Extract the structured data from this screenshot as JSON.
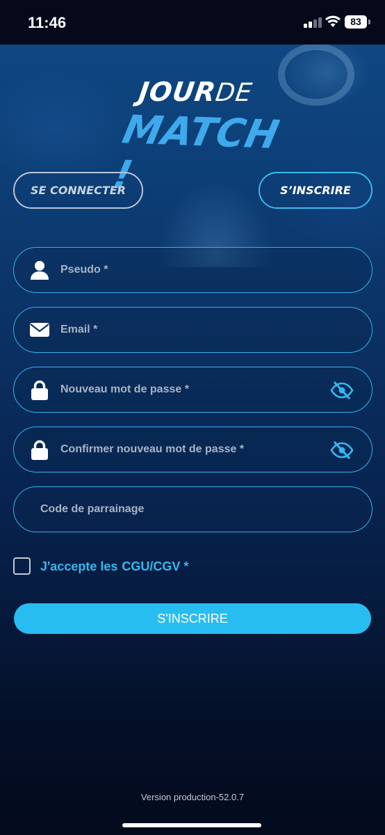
{
  "status_bar": {
    "time": "11:46",
    "battery": "83"
  },
  "logo": {
    "jour": "JOUR",
    "de": "DE",
    "match": "MATCH !"
  },
  "tabs": {
    "login": "SE CONNECTER",
    "signup": "S’INSCRIRE",
    "active": "signup"
  },
  "form": {
    "pseudo_placeholder": "Pseudo *",
    "email_placeholder": "Email *",
    "password_placeholder": "Nouveau mot de passe *",
    "confirm_placeholder": "Confirmer nouveau mot de passe *",
    "referral_placeholder": "Code de parrainage",
    "accept_text": "J'accepte les",
    "cgu_link": "CGU/CGV *",
    "accepted": false,
    "submit_label": "S'INSCRIRE"
  },
  "footer": {
    "version": "Version production-52.0.7"
  },
  "colors": {
    "accent": "#28bdf0",
    "field_border": "#34b2ec",
    "background_top": "#0f4a86",
    "background_bottom": "#030a1c"
  },
  "icons": {
    "pseudo": "user-icon",
    "email": "envelope-icon",
    "password": "lock-icon",
    "toggle_visibility": "eye-slash-icon"
  }
}
